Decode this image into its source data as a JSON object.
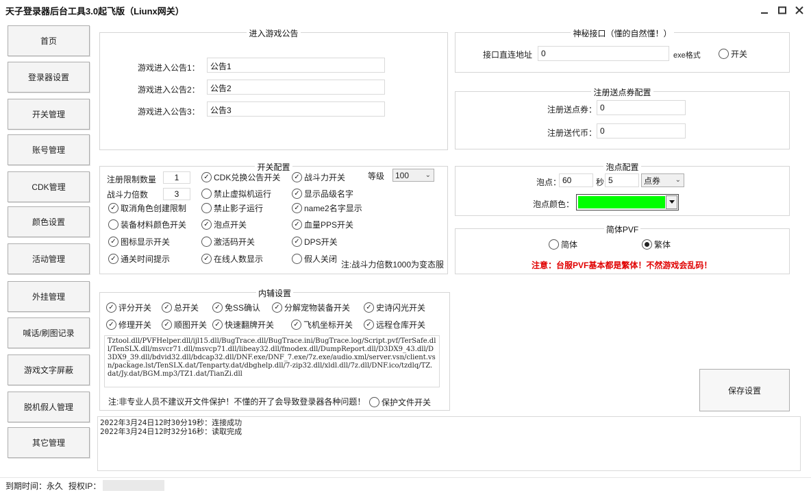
{
  "window": {
    "title": "天子登录器后台工具3.0起飞版（Liunx网关）"
  },
  "nav": [
    "首页",
    "登录器设置",
    "开关管理",
    "账号管理",
    "CDK管理",
    "颜色设置",
    "活动管理",
    "外挂管理",
    "喊话/刷图记录",
    "游戏文字屏蔽",
    "脱机假人管理",
    "其它管理"
  ],
  "notice": {
    "title": "进入游戏公告",
    "rows": [
      {
        "label": "游戏进入公告1：",
        "value": "公告1"
      },
      {
        "label": "游戏进入公告2：",
        "value": "公告2"
      },
      {
        "label": "游戏进入公告3：",
        "value": "公告3"
      }
    ]
  },
  "secret": {
    "title": "神秘接口（懂的自然懂！）",
    "label": "接口直连地址",
    "value": "0",
    "format": "exe格式",
    "switch_label": "开关"
  },
  "register": {
    "title": "注册送点券配置",
    "points_label": "注册送点券：",
    "points_value": "0",
    "coins_label": "注册送代币：",
    "coins_value": "0"
  },
  "switches": {
    "title": "开关配置",
    "reg_limit_label": "注册限制数量",
    "reg_limit_value": "1",
    "power_mult_label": "战斗力倍数",
    "power_mult_value": "3",
    "level_label": "等级",
    "level_value": "100",
    "items": [
      {
        "label": "CDK兑换公告开关",
        "checked": true
      },
      {
        "label": "战斗力开关",
        "checked": true
      },
      {
        "label": "禁止虚拟机运行",
        "checked": false
      },
      {
        "label": "显示品级名字",
        "checked": true
      },
      {
        "label": "取消角色创建限制",
        "checked": true
      },
      {
        "label": "禁止影子运行",
        "checked": false
      },
      {
        "label": "name2名字显示",
        "checked": true
      },
      {
        "label": "装备材料颜色开关",
        "checked": false
      },
      {
        "label": "泡点开关",
        "checked": true
      },
      {
        "label": "血量PPS开关",
        "checked": true
      },
      {
        "label": "图标显示开关",
        "checked": true
      },
      {
        "label": "激活码开关",
        "checked": false
      },
      {
        "label": "DPS开关",
        "checked": true
      },
      {
        "label": "通关时间提示",
        "checked": true
      },
      {
        "label": "在线人数显示",
        "checked": true
      },
      {
        "label": "假人关闭",
        "checked": false
      }
    ],
    "note": "注:战斗力倍数1000为变态服"
  },
  "bubble": {
    "title": "泡点配置",
    "label": "泡点：",
    "value": "60",
    "sec_label": "秒",
    "sec_value": "5",
    "unit": "点券",
    "color_label": "泡点颜色：",
    "color": "#00ff00"
  },
  "pvf": {
    "title": "简体PVF",
    "simplified": "简体",
    "traditional": "繁体",
    "selected": "traditional",
    "warning": "注意：台服PVF基本都是繁体！不然游戏会乱码！"
  },
  "inner": {
    "title": "内辅设置",
    "items": [
      {
        "label": "评分开关",
        "checked": true
      },
      {
        "label": "总开关",
        "checked": true
      },
      {
        "label": "免SS确认",
        "checked": true
      },
      {
        "label": "分解宠物装备开关",
        "checked": true
      },
      {
        "label": "史诗闪光开关",
        "checked": true
      },
      {
        "label": "修理开关",
        "checked": true
      },
      {
        "label": "顺图开关",
        "checked": true
      },
      {
        "label": "快速翻牌开关",
        "checked": true
      },
      {
        "label": "飞机坐标开关",
        "checked": true
      },
      {
        "label": "远程仓库开关",
        "checked": true
      }
    ],
    "files": "Tztool.dll/PVFHelper.dll/ijl15.dll/BugTrace.dll/BugTrace.ini/BugTrace.log/Script.pvf/TerSafe.dll/TenSLX.dll/msvcr71.dll/msvcp71.dll/libeay32.dll/fmodex.dll/DumpReport.dll/D3DX9_43.dll/D3DX9_39.dll/bdvid32.dll/bdcap32.dll/DNF.exe/DNF_7.exe/7z.exe/audio.xml/server.vsn/client.vsn/package.lst/TenSLX.dat/Tenparty.dat/dbghelp.dll/7-zip32.dll/xldl.dll/7z.dll/DNF.ico/tzdlq/TZ.dat/Jy.dat/BGM.mp3/TZ1.dat/TianZi.dll",
    "note": "注:非专业人员不建议开文件保护！不懂的开了会导致登录器各种问题！",
    "protect_label": "保护文件开关"
  },
  "save_label": "保存设置",
  "log": [
    "2022年3月24日12时30分19秒：连接成功",
    "2022年3月24日12时32分16秒：读取完成"
  ],
  "status": {
    "expire_label": "到期时间：",
    "expire_value": "永久",
    "ip_label": "授权IP："
  }
}
